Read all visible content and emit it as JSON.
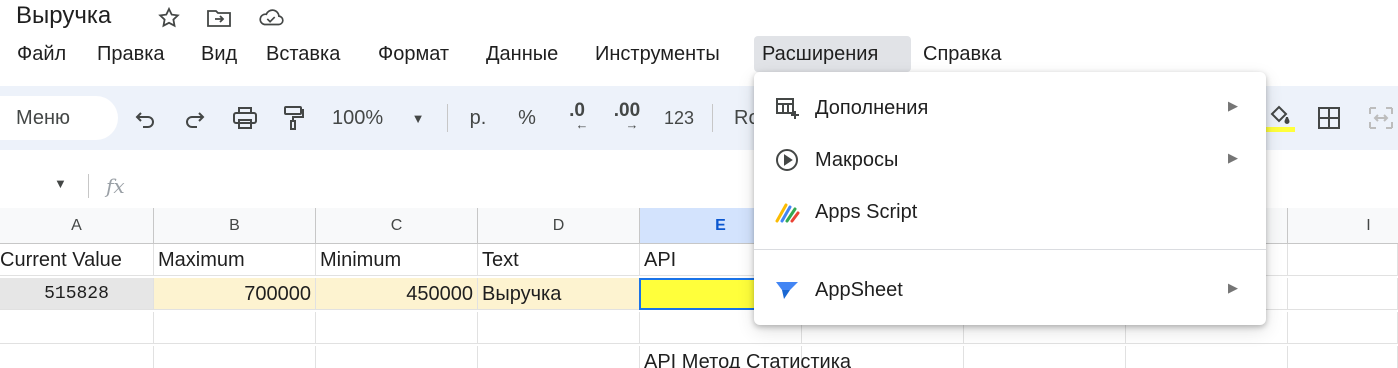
{
  "document": {
    "title": "Выручка"
  },
  "menubar": {
    "items": [
      "Файл",
      "Правка",
      "Вид",
      "Вставка",
      "Формат",
      "Данные",
      "Инструменты",
      "Расширения",
      "Справка"
    ]
  },
  "toolbar": {
    "menu_search": "Меню",
    "zoom": "100%",
    "currency": "р.",
    "percent": "%",
    "decrease_decimals": ".0",
    "increase_decimals": ".00",
    "number_format": "123",
    "font_partial": "Ro"
  },
  "formula_bar": {
    "fx": "fx"
  },
  "grid": {
    "columns": [
      "A",
      "B",
      "C",
      "D",
      "E",
      "I"
    ],
    "row1": [
      "Current Value",
      "Maximum",
      "Minimum",
      "Text",
      "API"
    ],
    "row2": [
      "515828",
      "700000",
      "450000",
      "Выручка"
    ],
    "row4_e": "API Метод Статистика"
  },
  "extensions_menu": {
    "items": [
      {
        "label": "Дополнения",
        "icon": "addons-icon",
        "submenu": true
      },
      {
        "label": "Макросы",
        "icon": "play-circle-icon",
        "submenu": true
      },
      {
        "label": "Apps Script",
        "icon": "apps-script-icon",
        "submenu": false
      },
      {
        "label": "AppSheet",
        "icon": "appsheet-icon",
        "submenu": true
      }
    ],
    "submenu_arrow": "▶"
  },
  "colors": {
    "toolbar_bg": "#edf2fa",
    "selected_col": "#d3e3fd",
    "highlight_yellow": "#ffff3b",
    "cell_beige": "#fdf3d0",
    "selection_blue": "#1a73e8"
  }
}
